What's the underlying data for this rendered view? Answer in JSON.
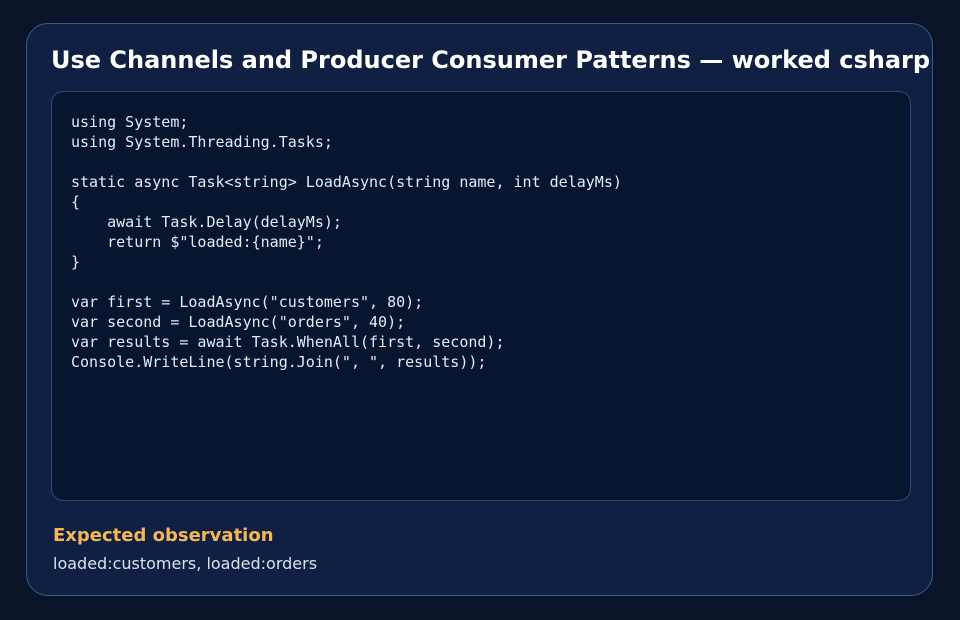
{
  "card": {
    "title": "Use Channels and Producer Consumer Patterns — worked csharp example"
  },
  "code": {
    "text": "using System;\nusing System.Threading.Tasks;\n\nstatic async Task<string> LoadAsync(string name, int delayMs)\n{\n    await Task.Delay(delayMs);\n    return $\"loaded:{name}\";\n}\n\nvar first = LoadAsync(\"customers\", 80);\nvar second = LoadAsync(\"orders\", 40);\nvar results = await Task.WhenAll(first, second);\nConsole.WriteLine(string.Join(\", \", results));"
  },
  "observation": {
    "heading": "Expected observation",
    "text": "loaded:customers, loaded:orders"
  }
}
